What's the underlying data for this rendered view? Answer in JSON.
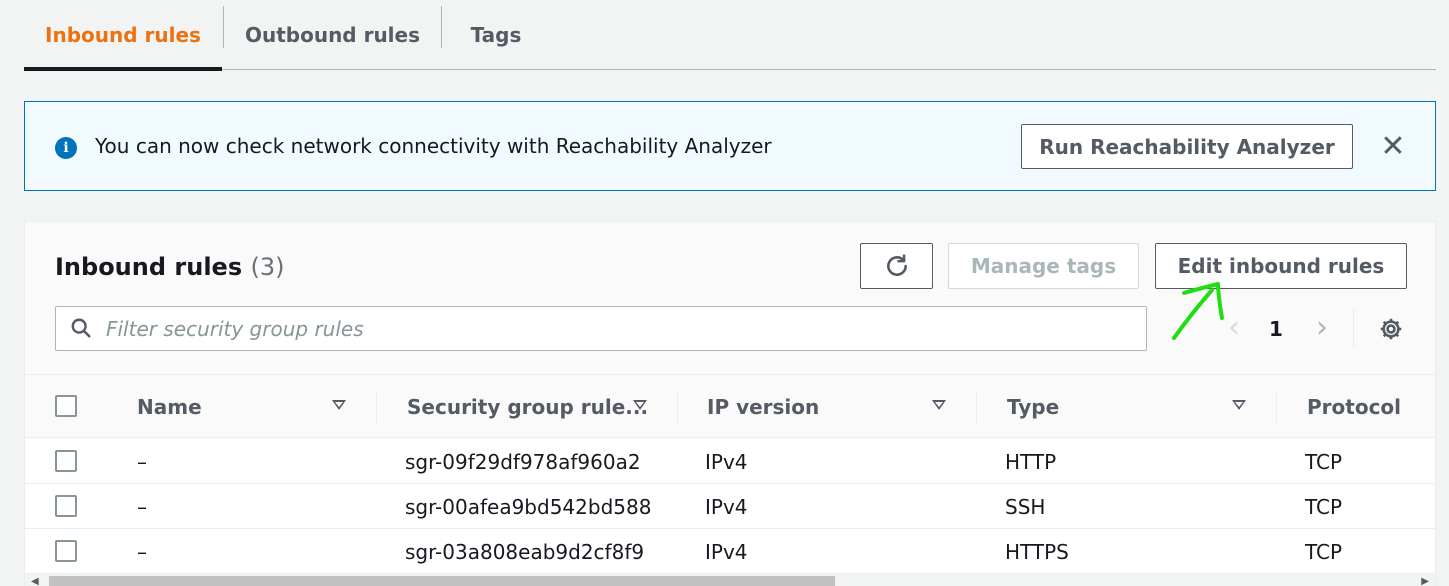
{
  "tabs": [
    {
      "label": "Inbound rules",
      "active": true
    },
    {
      "label": "Outbound rules",
      "active": false
    },
    {
      "label": "Tags",
      "active": false
    }
  ],
  "banner": {
    "icon": "info-icon",
    "text": "You can now check network connectivity with Reachability Analyzer",
    "button_label": "Run Reachability Analyzer",
    "close_icon": "close-icon"
  },
  "panel": {
    "title": "Inbound rules",
    "count": "(3)",
    "refresh_icon": "refresh-icon",
    "manage_tags_label": "Manage tags",
    "edit_label": "Edit inbound rules",
    "search_placeholder": "Filter security group rules",
    "pagination": {
      "current_page": "1"
    },
    "settings_icon": "gear-icon"
  },
  "table": {
    "columns": [
      "Name",
      "Security group rule...",
      "IP version",
      "Type",
      "Protocol"
    ],
    "rows": [
      {
        "name": "–",
        "rule_id": "sgr-09f29df978af960a2",
        "ip_version": "IPv4",
        "type": "HTTP",
        "protocol": "TCP"
      },
      {
        "name": "–",
        "rule_id": "sgr-00afea9bd542bd588",
        "ip_version": "IPv4",
        "type": "SSH",
        "protocol": "TCP"
      },
      {
        "name": "–",
        "rule_id": "sgr-03a808eab9d2cf8f9",
        "ip_version": "IPv4",
        "type": "HTTPS",
        "protocol": "TCP"
      }
    ]
  },
  "colors": {
    "accent_orange": "#ec7211",
    "info_blue": "#0073bb",
    "annotation_green": "#22dd11"
  }
}
